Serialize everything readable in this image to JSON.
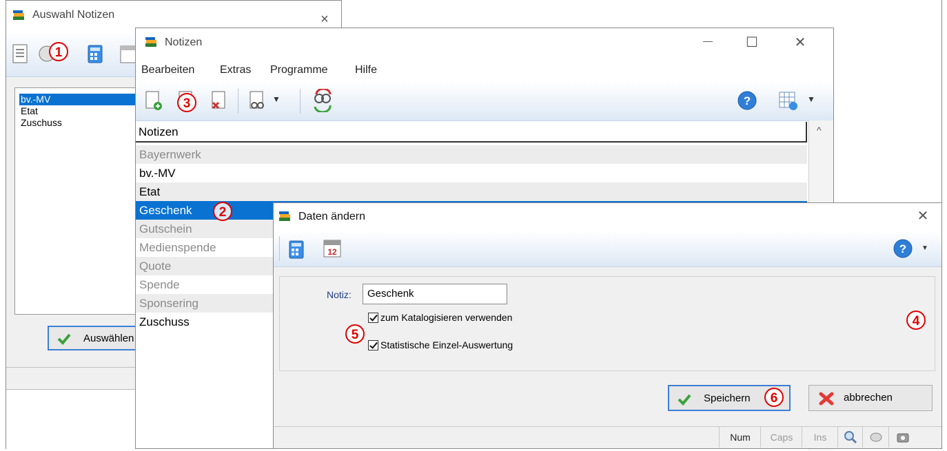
{
  "win_auswahl": {
    "title": "Auswahl Notizen",
    "close_glyph": "×",
    "list": [
      "bv.-MV",
      "Etat",
      "Zuschuss"
    ],
    "select_button": "Auswählen",
    "marker": "1"
  },
  "win_notizen": {
    "title": "Notizen",
    "min_glyph": "—",
    "max_glyph": "☐",
    "close_glyph": "✕",
    "menu": [
      "Bearbeiten",
      "Extras",
      "Programme",
      "Hilfe"
    ],
    "marker_toolbar": "3",
    "column_header": "Notizen",
    "rows": [
      {
        "label": "Bayernwerk",
        "active": false
      },
      {
        "label": "bv.-MV",
        "active": true
      },
      {
        "label": "Etat",
        "active": true
      },
      {
        "label": "Geschenk",
        "active": true,
        "selected": true
      },
      {
        "label": "Gutschein",
        "active": false
      },
      {
        "label": "Medienspende",
        "active": false
      },
      {
        "label": "Quote",
        "active": false
      },
      {
        "label": "Spende",
        "active": false
      },
      {
        "label": "Sponsering",
        "active": false
      },
      {
        "label": "Zuschuss",
        "active": true
      }
    ],
    "marker_row": "2"
  },
  "win_daten": {
    "title": "Daten ändern",
    "close_glyph": "✕",
    "notiz_label": "Notiz:",
    "notiz_value": "Geschenk",
    "check1": "zum Katalogisieren verwenden",
    "check2": "Statistische Einzel-Auswertung",
    "save_label": "Speichern",
    "cancel_label": "abbrechen",
    "marker_panel": "4",
    "marker_checks": "5",
    "marker_save": "6",
    "status": [
      "Num",
      "Caps",
      "Ins"
    ]
  },
  "colors": {
    "selection": "#0a72d1",
    "marker": "#e00000",
    "toolbar_bottom": "#dde8f5"
  }
}
